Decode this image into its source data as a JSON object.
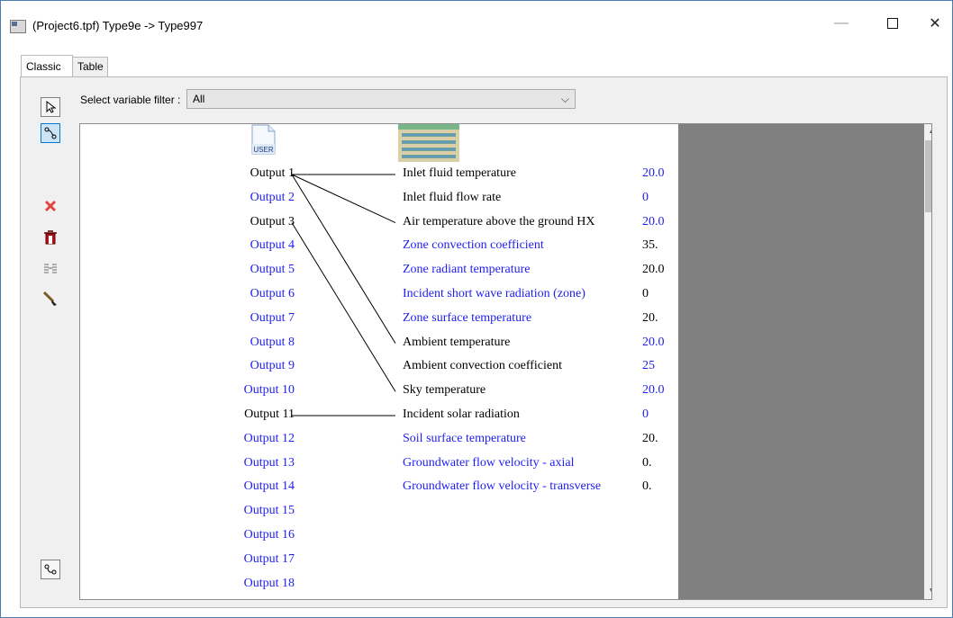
{
  "window": {
    "title": "(Project6.tpf) Type9e -> Type997",
    "minimize_glyph": "—",
    "close_glyph": "✕"
  },
  "tabs": [
    {
      "label": "Classic",
      "active": true
    },
    {
      "label": "Table",
      "active": false
    }
  ],
  "filter": {
    "label": "Select variable filter :",
    "value": "All",
    "chevron": "⌵"
  },
  "toolbar": {
    "tools": [
      {
        "name": "pointer-tool",
        "icon": "arrow-pointer-icon",
        "selected": false
      },
      {
        "name": "link-tool",
        "icon": "link-wire-icon",
        "selected": true
      },
      {
        "name": "delete-link-tool",
        "icon": "red-x-icon",
        "selected": false
      },
      {
        "name": "delete-all-links-tool",
        "icon": "trash-icon",
        "selected": false
      },
      {
        "name": "auto-link-tool",
        "icon": "list-link-icon",
        "selected": false
      },
      {
        "name": "paint-tool",
        "icon": "brush-icon",
        "selected": false
      },
      {
        "name": "link-mode-tool",
        "icon": "connect-icon",
        "selected": false
      }
    ]
  },
  "source": {
    "icon": "user-file-icon",
    "icon_text": "USER",
    "outputs": [
      {
        "label": "Output 1",
        "linked": true
      },
      {
        "label": "Output 2",
        "linked": false
      },
      {
        "label": "Output 3",
        "linked": true
      },
      {
        "label": "Output 4",
        "linked": false
      },
      {
        "label": "Output 5",
        "linked": false
      },
      {
        "label": "Output 6",
        "linked": false
      },
      {
        "label": "Output 7",
        "linked": false
      },
      {
        "label": "Output 8",
        "linked": false
      },
      {
        "label": "Output 9",
        "linked": false
      },
      {
        "label": "Output 10",
        "linked": false
      },
      {
        "label": "Output 11",
        "linked": true
      },
      {
        "label": "Output 12",
        "linked": false
      },
      {
        "label": "Output 13",
        "linked": false
      },
      {
        "label": "Output 14",
        "linked": false
      },
      {
        "label": "Output 15",
        "linked": false
      },
      {
        "label": "Output 16",
        "linked": false
      },
      {
        "label": "Output 17",
        "linked": false
      },
      {
        "label": "Output 18",
        "linked": false
      }
    ]
  },
  "target": {
    "icon": "ground-heat-exchanger-icon",
    "inputs": [
      {
        "label": "Inlet fluid temperature",
        "value": "20.0",
        "label_linked": true,
        "value_color": "blue"
      },
      {
        "label": "Inlet fluid flow rate",
        "value": "0",
        "label_linked": true,
        "value_color": "blue"
      },
      {
        "label": "Air temperature above the ground HX",
        "value": "20.0",
        "label_linked": true,
        "value_color": "blue"
      },
      {
        "label": "Zone convection coefficient",
        "value": "35.",
        "label_linked": false,
        "value_color": "black"
      },
      {
        "label": "Zone radiant temperature",
        "value": "20.0",
        "label_linked": false,
        "value_color": "black"
      },
      {
        "label": "Incident short wave radiation (zone)",
        "value": "0",
        "label_linked": false,
        "value_color": "black"
      },
      {
        "label": "Zone surface temperature",
        "value": "20.",
        "label_linked": false,
        "value_color": "black"
      },
      {
        "label": "Ambient temperature",
        "value": "20.0",
        "label_linked": true,
        "value_color": "blue"
      },
      {
        "label": "Ambient convection coefficient",
        "value": "25",
        "label_linked": true,
        "value_color": "blue"
      },
      {
        "label": "Sky temperature",
        "value": "20.0",
        "label_linked": true,
        "value_color": "blue"
      },
      {
        "label": "Incident solar radiation",
        "value": "0",
        "label_linked": true,
        "value_color": "blue"
      },
      {
        "label": "Soil surface temperature",
        "value": "20.",
        "label_linked": false,
        "value_color": "black"
      },
      {
        "label": "Groundwater flow velocity - axial",
        "value": "0.",
        "label_linked": false,
        "value_color": "black"
      },
      {
        "label": "Groundwater flow velocity - transverse",
        "value": "0.",
        "label_linked": false,
        "value_color": "black"
      }
    ]
  },
  "links": [
    {
      "from": "Output 1",
      "to": "Inlet fluid temperature"
    },
    {
      "from": "Output 1",
      "to": "Air temperature above the ground HX"
    },
    {
      "from": "Output 1",
      "to": "Ambient temperature"
    },
    {
      "from": "Output 3",
      "to": "Sky temperature"
    },
    {
      "from": "Output 11",
      "to": "Incident solar radiation"
    }
  ],
  "colors": {
    "linked_text": "#000000",
    "unlinked_text": "#1e1ef0",
    "link_line": "#000000",
    "panel_gray": "#808080"
  }
}
